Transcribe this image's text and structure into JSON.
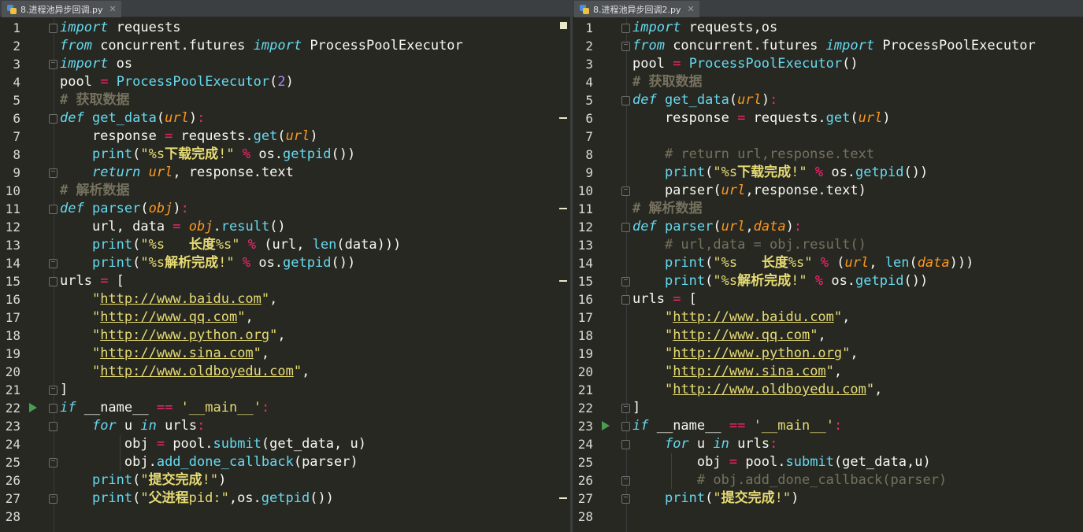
{
  "left": {
    "tab": "8.进程池异步回调.py",
    "lines": [
      "import requests",
      "from concurrent.futures import ProcessPoolExecutor",
      "import os",
      "pool = ProcessPoolExecutor(2)",
      "# 获取数据",
      "def get_data(url):",
      "    response = requests.get(url)",
      "    print(\"%s下载完成!\" % os.getpid())",
      "    return url, response.text",
      "# 解析数据",
      "def parser(obj):",
      "    url, data = obj.result()",
      "    print(\"%s   长度%s\" % (url, len(data)))",
      "    print(\"%s解析完成!\" % os.getpid())",
      "urls = [",
      "    \"http://www.baidu.com\",",
      "    \"http://www.qq.com\",",
      "    \"http://www.python.org\",",
      "    \"http://www.sina.com\",",
      "    \"http://www.oldboyedu.com\",",
      "]",
      "if __name__ == '__main__':",
      "    for u in urls:",
      "        obj = pool.submit(get_data, u)",
      "        obj.add_done_callback(parser)",
      "    print(\"提交完成!\")",
      "    print(\"父进程pid:\",os.getpid())",
      ""
    ]
  },
  "right": {
    "tab": "8.进程池异步回调2.py",
    "lines": [
      "import requests,os",
      "from concurrent.futures import ProcessPoolExecutor",
      "pool = ProcessPoolExecutor()",
      "# 获取数据",
      "def get_data(url):",
      "    response = requests.get(url)",
      "",
      "    # return url,response.text",
      "    print(\"%s下载完成!\" % os.getpid())",
      "    parser(url,response.text)",
      "# 解析数据",
      "def parser(url,data):",
      "    # url,data = obj.result()",
      "    print(\"%s   长度%s\" % (url, len(data)))",
      "    print(\"%s解析完成!\" % os.getpid())",
      "urls = [",
      "    \"http://www.baidu.com\",",
      "    \"http://www.qq.com\",",
      "    \"http://www.python.org\",",
      "    \"http://www.sina.com\",",
      "    \"http://www.oldboyedu.com\",",
      "]",
      "if __name__ == '__main__':",
      "    for u in urls:",
      "        obj = pool.submit(get_data,u)",
      "        # obj.add_done_callback(parser)",
      "    print(\"提交完成!\")",
      ""
    ]
  },
  "colors": {
    "keyword": "#66d9ef",
    "operator": "#f92672",
    "string": "#e6db74",
    "number": "#ae81ff",
    "param": "#fd971f",
    "comment": "#75715e",
    "background": "#272822"
  }
}
